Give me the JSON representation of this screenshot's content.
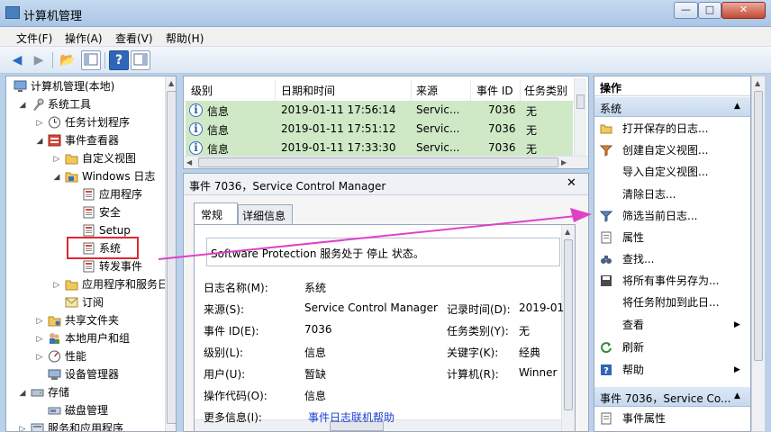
{
  "window": {
    "title": "计算机管理"
  },
  "menu": [
    "文件(F)",
    "操作(A)",
    "查看(V)",
    "帮助(H)"
  ],
  "tree": {
    "items": [
      {
        "label": "计算机管理(本地)",
        "icon": "computer-icon"
      },
      {
        "label": "系统工具",
        "icon": "tools-icon"
      },
      {
        "label": "任务计划程序",
        "icon": "clock-icon"
      },
      {
        "label": "事件查看器",
        "icon": "event-viewer-icon"
      },
      {
        "label": "自定义视图",
        "icon": "folder-icon"
      },
      {
        "label": "Windows 日志",
        "icon": "folder-icon"
      },
      {
        "label": "应用程序",
        "icon": "log-icon"
      },
      {
        "label": "安全",
        "icon": "log-icon"
      },
      {
        "label": "Setup",
        "icon": "log-icon"
      },
      {
        "label": "系统",
        "icon": "log-icon"
      },
      {
        "label": "转发事件",
        "icon": "log-icon"
      },
      {
        "label": "应用程序和服务日",
        "icon": "folder-icon"
      },
      {
        "label": "订阅",
        "icon": "subscription-icon"
      },
      {
        "label": "共享文件夹",
        "icon": "shared-folder-icon"
      },
      {
        "label": "本地用户和组",
        "icon": "users-icon"
      },
      {
        "label": "性能",
        "icon": "performance-icon"
      },
      {
        "label": "设备管理器",
        "icon": "device-manager-icon"
      },
      {
        "label": "存储",
        "icon": "storage-icon"
      },
      {
        "label": "磁盘管理",
        "icon": "disk-icon"
      },
      {
        "label": "服务和应用程序",
        "icon": "services-icon"
      }
    ]
  },
  "event_list": {
    "columns": [
      "级别",
      "日期和时间",
      "来源",
      "事件 ID",
      "任务类别"
    ],
    "rows": [
      {
        "level": "信息",
        "datetime": "2019-01-11 17:56:14",
        "source": "Servic...",
        "event_id": "7036",
        "task": "无"
      },
      {
        "level": "信息",
        "datetime": "2019-01-11 17:51:12",
        "source": "Servic...",
        "event_id": "7036",
        "task": "无"
      },
      {
        "level": "信息",
        "datetime": "2019-01-11 17:33:30",
        "source": "Servic...",
        "event_id": "7036",
        "task": "无"
      }
    ]
  },
  "detail": {
    "header": "事件 7036，Service Control Manager",
    "tabs": [
      "常规",
      "详细信息"
    ],
    "message": "Software Protection 服务处于 停止 状态。",
    "labels": {
      "log_name": "日志名称(M):",
      "source": "来源(S):",
      "event_id": "事件 ID(E):",
      "level": "级别(L):",
      "user": "用户(U):",
      "opcode": "操作代码(O):",
      "more_info": "更多信息(I):",
      "logged": "记录时间(D):",
      "task": "任务类别(Y):",
      "keywords": "关键字(K):",
      "computer": "计算机(R):"
    },
    "values": {
      "log_name": "系统",
      "source": "Service Control Manager",
      "event_id": "7036",
      "level": "信息",
      "user": "暂缺",
      "opcode": "信息",
      "more_info": "事件日志联机帮助",
      "logged": "2019-01",
      "task": "无",
      "keywords": "经典",
      "computer": "Winner"
    }
  },
  "actions": {
    "header": "操作",
    "section1": "系统",
    "items": [
      {
        "label": "打开保存的日志...",
        "icon": "open-folder-icon"
      },
      {
        "label": "创建自定义视图...",
        "icon": "filter-icon"
      },
      {
        "label": "导入自定义视图...",
        "icon": ""
      },
      {
        "label": "清除日志...",
        "icon": ""
      },
      {
        "label": "筛选当前日志...",
        "icon": "filter-icon"
      },
      {
        "label": "属性",
        "icon": "properties-icon"
      },
      {
        "label": "查找...",
        "icon": "binoculars-icon"
      },
      {
        "label": "将所有事件另存为...",
        "icon": "save-icon"
      },
      {
        "label": "将任务附加到此日...",
        "icon": ""
      },
      {
        "label": "查看",
        "icon": ""
      },
      {
        "label": "刷新",
        "icon": "refresh-icon"
      },
      {
        "label": "帮助",
        "icon": "help-icon"
      }
    ],
    "section2": "事件 7036，Service Co...",
    "items2": [
      {
        "label": "事件属性",
        "icon": "properties-icon"
      }
    ]
  },
  "colors": {
    "selected_row": "#cfe8c6",
    "highlight_box": "#e0282f",
    "arrow": "#e040c8",
    "link": "#1a3fd0"
  }
}
